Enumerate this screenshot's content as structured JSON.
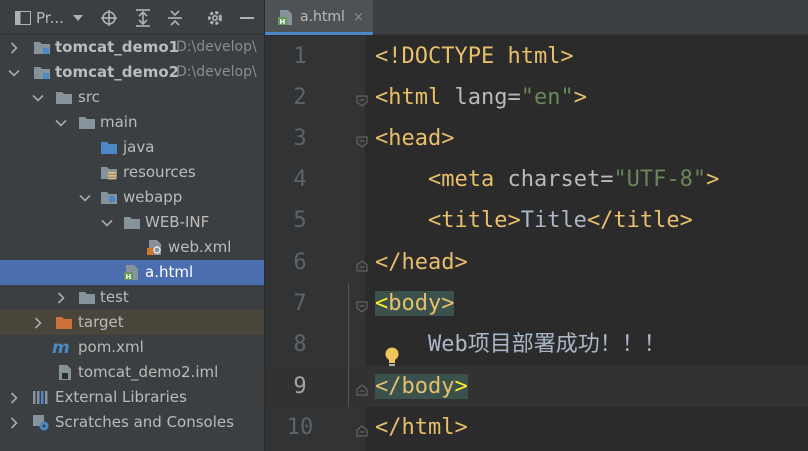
{
  "project_panel": {
    "title": "Pr...",
    "tree": [
      {
        "label": "tomcat_demo1",
        "path": "D:\\develop\\",
        "expanded": false,
        "bold": true
      },
      {
        "label": "tomcat_demo2",
        "path": "D:\\develop\\",
        "expanded": true,
        "bold": true
      },
      {
        "label": "src",
        "expanded": true
      },
      {
        "label": "main",
        "expanded": true
      },
      {
        "label": "java"
      },
      {
        "label": "resources"
      },
      {
        "label": "webapp",
        "expanded": true
      },
      {
        "label": "WEB-INF",
        "expanded": true
      },
      {
        "label": "web.xml"
      },
      {
        "label": "a.html",
        "selected": true
      },
      {
        "label": "test",
        "expanded": false
      },
      {
        "label": "target",
        "expanded": false
      },
      {
        "label": "pom.xml"
      },
      {
        "label": "tomcat_demo2.iml"
      },
      {
        "label": "External Libraries",
        "expanded": false
      },
      {
        "label": "Scratches and Consoles",
        "expanded": false
      }
    ]
  },
  "editor": {
    "tab": {
      "label": "a.html",
      "close": "×"
    },
    "current_line": 9,
    "line_numbers": [
      "1",
      "2",
      "3",
      "4",
      "5",
      "6",
      "7",
      "8",
      "9",
      "10"
    ],
    "lines": {
      "l1": {
        "a": "<!DOCTYPE html>"
      },
      "l2": {
        "a": "<html ",
        "b": "lang",
        "c": "=",
        "d": "\"en\"",
        "e": ">"
      },
      "l3": {
        "a": "<head>"
      },
      "l4": {
        "pre": "    ",
        "a": "<meta ",
        "b": "charset",
        "c": "=",
        "d": "\"UTF-8\"",
        "e": ">"
      },
      "l5": {
        "pre": "    ",
        "a": "<title>",
        "b": "Title",
        "c": "</title>"
      },
      "l6": {
        "a": "</head>"
      },
      "l7": {
        "a": "<",
        "b": "body",
        "c": ">"
      },
      "l8": {
        "pre": "    ",
        "a": "Web项目部署成功！！！"
      },
      "l9": {
        "a": "</",
        "b": "body",
        "c": ">"
      },
      "l10": {
        "a": "</html>"
      }
    }
  },
  "colors": {
    "tag": "#e8bf6a",
    "string": "#6a8759",
    "selection": "#4b6eaf",
    "brace_match": "#3b514d"
  }
}
